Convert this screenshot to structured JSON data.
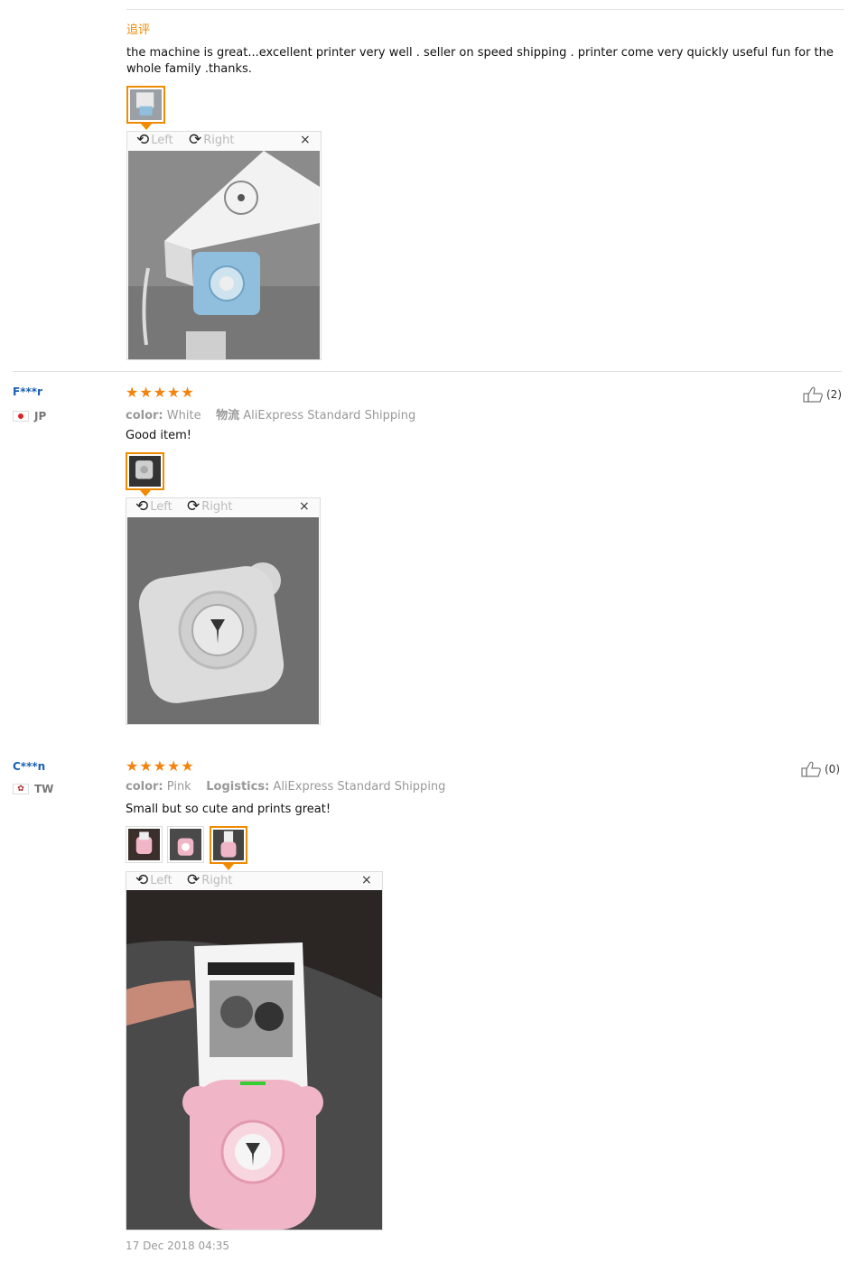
{
  "review1": {
    "followup_label": "追评",
    "followup_text": "the machine is great...excellent printer very well . seller on speed shipping . printer come very quickly useful fun for the whole family .thanks.",
    "viewer": {
      "left": "Left",
      "right": "Right",
      "close": "×"
    }
  },
  "review2": {
    "user": "F***r",
    "country": "JP",
    "rating": 5,
    "color_label": "color:",
    "color_value": "White",
    "shipping_label": "物流",
    "shipping_value": "AliExpress Standard Shipping",
    "text": "Good item!",
    "likes": "(2)",
    "viewer": {
      "left": "Left",
      "right": "Right",
      "close": "×"
    }
  },
  "review3": {
    "user": "C***n",
    "country": "TW",
    "rating": 5,
    "color_label": "color:",
    "color_value": "Pink",
    "shipping_label": "Logistics:",
    "shipping_value": "AliExpress Standard Shipping",
    "text": "Small but so cute and prints great!",
    "likes": "(0)",
    "date": "17 Dec 2018 04:35",
    "viewer": {
      "left": "Left",
      "right": "Right",
      "close": "×"
    }
  },
  "colors": {
    "star": "#f5820a",
    "accent": "#f08a00",
    "username": "#1a5fb4",
    "printer_blue": "#8fbfdc",
    "printer_white": "#d9d9d9",
    "printer_pink": "#f0b6c8"
  }
}
